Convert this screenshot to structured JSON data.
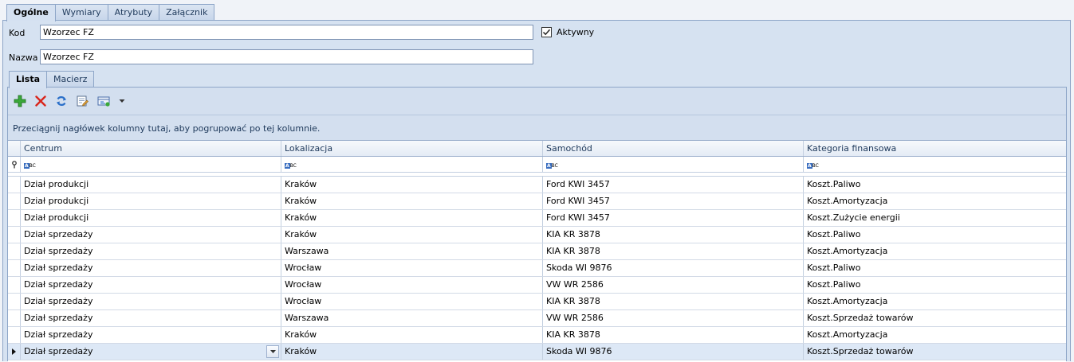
{
  "tabs_top": [
    {
      "label": "Ogólne",
      "active": true
    },
    {
      "label": "Wymiary",
      "active": false
    },
    {
      "label": "Atrybuty",
      "active": false
    },
    {
      "label": "Załącznik",
      "active": false
    }
  ],
  "form": {
    "kod_label": "Kod",
    "kod_value": "Wzorzec FZ",
    "nazwa_label": "Nazwa",
    "nazwa_value": "Wzorzec FZ",
    "aktywny_label": "Aktywny",
    "aktywny_checked": true
  },
  "tabs_inner": [
    {
      "label": "Lista",
      "active": true
    },
    {
      "label": "Macierz",
      "active": false
    }
  ],
  "toolbar": {
    "icons": [
      "add-icon",
      "delete-icon",
      "refresh-icon",
      "edit-icon",
      "view-icon",
      "dropdown-arrow-icon"
    ],
    "colors": {
      "add": "#2fa02f",
      "delete": "#d9261c",
      "refresh": "#2a6fc9"
    }
  },
  "grid": {
    "group_hint": "Przeciągnij nagłówek kolumny tutaj, aby pogrupować po tej kolumnie.",
    "columns": [
      "Centrum",
      "Lokalizacja",
      "Samochód",
      "Kategoria finansowa"
    ],
    "filter_icon": "abc-filter-icon",
    "rows": [
      [
        "Dział produkcji",
        "Kraków",
        "Ford KWI 3457",
        "Koszt.Paliwo"
      ],
      [
        "Dział produkcji",
        "Kraków",
        "Ford KWI 3457",
        "Koszt.Amortyzacja"
      ],
      [
        "Dział produkcji",
        "Kraków",
        "Ford KWI 3457",
        "Koszt.Zużycie energii"
      ],
      [
        "Dział sprzedaży",
        "Kraków",
        "KIA KR 3878",
        "Koszt.Paliwo"
      ],
      [
        "Dział sprzedaży",
        "Warszawa",
        "KIA KR 3878",
        "Koszt.Amortyzacja"
      ],
      [
        "Dział sprzedaży",
        "Wrocław",
        "Skoda WI 9876",
        "Koszt.Paliwo"
      ],
      [
        "Dział sprzedaży",
        "Wrocław",
        "VW WR 2586",
        "Koszt.Paliwo"
      ],
      [
        "Dział sprzedaży",
        "Wrocław",
        "KIA KR 3878",
        "Koszt.Amortyzacja"
      ],
      [
        "Dział sprzedaży",
        "Warszawa",
        "VW WR 2586",
        "Koszt.Sprzedaż towarów"
      ],
      [
        "Dział sprzedaży",
        "Kraków",
        "KIA KR 3878",
        "Koszt.Amortyzacja"
      ],
      [
        "Dział sprzedaży",
        "Kraków",
        "Skoda WI 9876",
        "Koszt.Sprzedaż towarów"
      ]
    ]
  }
}
